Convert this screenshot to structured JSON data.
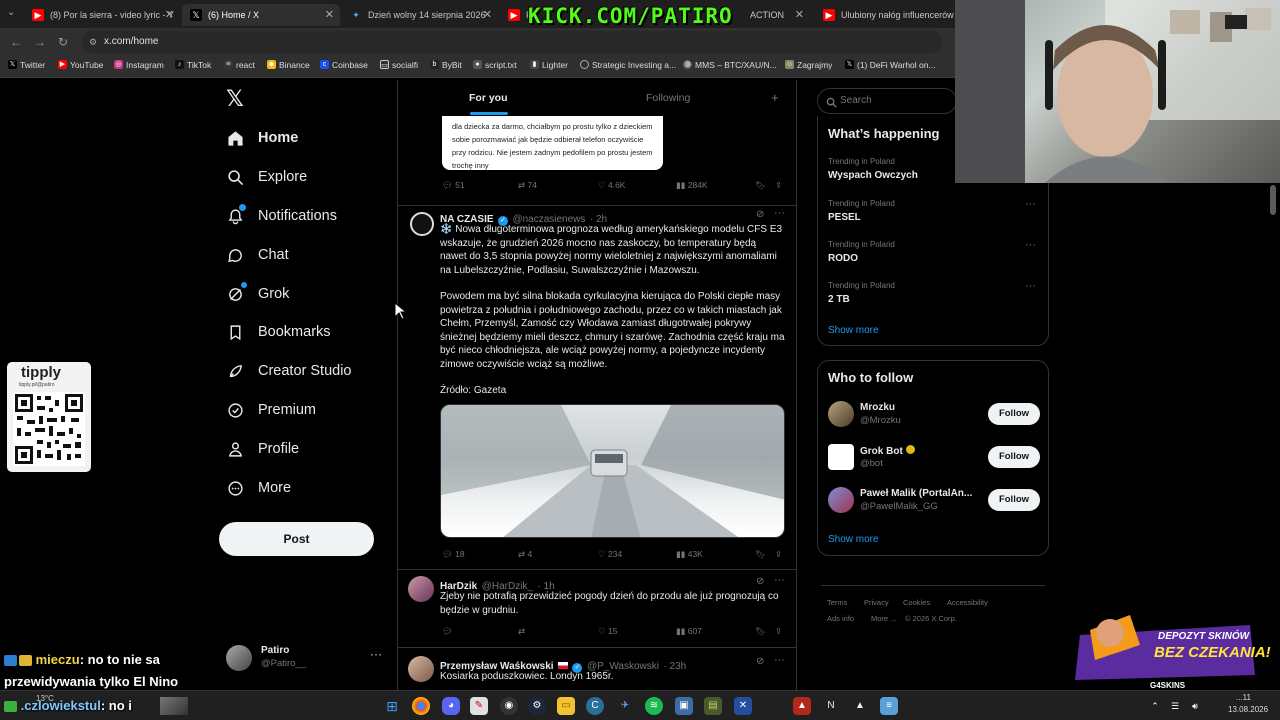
{
  "browser": {
    "tabs": [
      {
        "title": "(8) Por la sierra - video lyric - Y",
        "icon": "youtube-icon",
        "color": "#ff0000"
      },
      {
        "title": "(6) Home / X",
        "icon": "x-icon",
        "color": "#000000"
      },
      {
        "title": "Dzień wolny 14 sierpnia 2026",
        "icon": "bookmark-star-icon",
        "color": "#1a73e8"
      },
      {
        "title": "P",
        "icon": "youtube-icon",
        "color": "#ff0000"
      },
      {
        "title": "ACTION",
        "icon": "",
        "color": "#333333"
      },
      {
        "title": "Ulubiony nałóg influencerów -",
        "icon": "youtube-icon",
        "color": "#ff0000"
      }
    ],
    "url": "x.com/home",
    "bookmarks": [
      "Twitter",
      "YouTube",
      "Instagram",
      "TikTok",
      "react",
      "Binance",
      "Coinbase",
      "socialfi",
      "ByBit",
      "script.txt",
      "Lighter",
      "Strategic Investing a...",
      "MMS – BTC/XAU/N...",
      "Zagrajmy",
      "(1) DeFi Warhol on..."
    ]
  },
  "overlay": {
    "kick": "KICK.COM/PATIRO",
    "tippy_label": "tipply",
    "tippy_url": "tipply.pl/@patiro",
    "chat": [
      {
        "name": "mieczu",
        "text": ": no to nie sa"
      },
      {
        "name": "",
        "text": "przewidywania tylko El Nino"
      },
      {
        "name": ".czlowiekstul",
        "text": ": no i"
      }
    ],
    "promo_line1": "DEPOZYT SKINÓW",
    "promo_line2": "BEZ CZEKANIA!",
    "promo_brand": "G4SKINS"
  },
  "nav": {
    "items": [
      {
        "label": "Home",
        "icon": "home-icon"
      },
      {
        "label": "Explore",
        "icon": "search-icon"
      },
      {
        "label": "Notifications",
        "icon": "bell-icon"
      },
      {
        "label": "Chat",
        "icon": "chat-icon"
      },
      {
        "label": "Grok",
        "icon": "grok-icon"
      },
      {
        "label": "Bookmarks",
        "icon": "bookmark-icon"
      },
      {
        "label": "Creator Studio",
        "icon": "rocket-icon"
      },
      {
        "label": "Premium",
        "icon": "premium-icon"
      },
      {
        "label": "Profile",
        "icon": "person-icon"
      },
      {
        "label": "More",
        "icon": "more-icon"
      }
    ],
    "post_label": "Post",
    "account_name": "Patiro",
    "account_handle": "@Patiro__"
  },
  "feed": {
    "tab_for_you": "For you",
    "tab_following": "Following",
    "prev_post": {
      "image_text": "dla dziecka za darmo, chciałbym po prostu tylko z dzieckiem sobie porozmawiać jak będzie odbierał telefon oczywiście przy rodzicu. Nie jestem żadnym pedofilem po prostu jestem trochę inny",
      "replies": "51",
      "reposts": "74",
      "likes": "4.6K",
      "views": "284K"
    },
    "posts": [
      {
        "name": "NA CZASIE",
        "handle": "@naczasienews",
        "time": "· 2h",
        "text1": "❄️ Nowa długoterminowa prognoza według amerykańskiego modelu CFS E3 wskazuje, że grudzień 2026 mocno nas zaskoczy, bo temperatury będą nawet do 3,5 stopnia powyżej normy wieloletniej z największymi anomaliami na Lubelszczyźnie, Podlasiu, Suwalszczyźnie i Mazowszu.",
        "text2": "Powodem ma być silna blokada cyrkulacyjna kierująca do Polski ciepłe masy powietrza z południa i południowego zachodu, przez co w takich miastach jak Chełm, Przemyśl, Zamość czy Włodawa zamiast długotrwałej pokrywy śnieżnej będziemy mieli deszcz, chmury i szarówę. Zachodnia część kraju ma być nieco chłodniejsza, ale wciąż powyżej normy, a pojedyncze incydenty zimowe oczywiście wciąż są możliwe.",
        "text3": "Źródło: Gazeta",
        "replies": "18",
        "reposts": "4",
        "likes": "234",
        "views": "43K"
      },
      {
        "name": "HarDzik",
        "handle": "@HarDzik_",
        "time": "· 1h",
        "text1": "Zjeby nie potrafią przewidzieć pogody dzień do przodu ale już prognozują co będzie w grudniu.",
        "replies": "",
        "reposts": "",
        "likes": "15",
        "views": "607"
      },
      {
        "name": "Przemysław Waśkowski",
        "handle": "@P_Waskowski",
        "time": "· 23h",
        "text1": "Kosiarka poduszkowiec. Londyn 1965r."
      }
    ]
  },
  "sidebar": {
    "search_placeholder": "Search",
    "happening_title": "What’s happening",
    "trends": [
      {
        "context": "Trending in Poland",
        "title": "Wyspach Owczych"
      },
      {
        "context": "Trending in Poland",
        "title": "PESEL"
      },
      {
        "context": "Trending in Poland",
        "title": "RODO"
      },
      {
        "context": "Trending in Poland",
        "title": "2 TB"
      }
    ],
    "show_more": "Show more",
    "follow_title": "Who to follow",
    "follow": [
      {
        "name": "Mrozku",
        "handle": "@Mrozku"
      },
      {
        "name": "Grok Bot",
        "handle": "@bot"
      },
      {
        "name": "Paweł Malik (PortalAn...",
        "handle": "@PawelMalik_GG"
      }
    ],
    "follow_label": "Follow",
    "footer": [
      "Terms",
      "Privacy",
      "Cookies",
      "Accessibility",
      "Ads info",
      "More ...",
      "© 2026 X Corp."
    ]
  },
  "taskbar": {
    "temp": "13°C",
    "time": "...11",
    "date": "13.08.2026"
  }
}
